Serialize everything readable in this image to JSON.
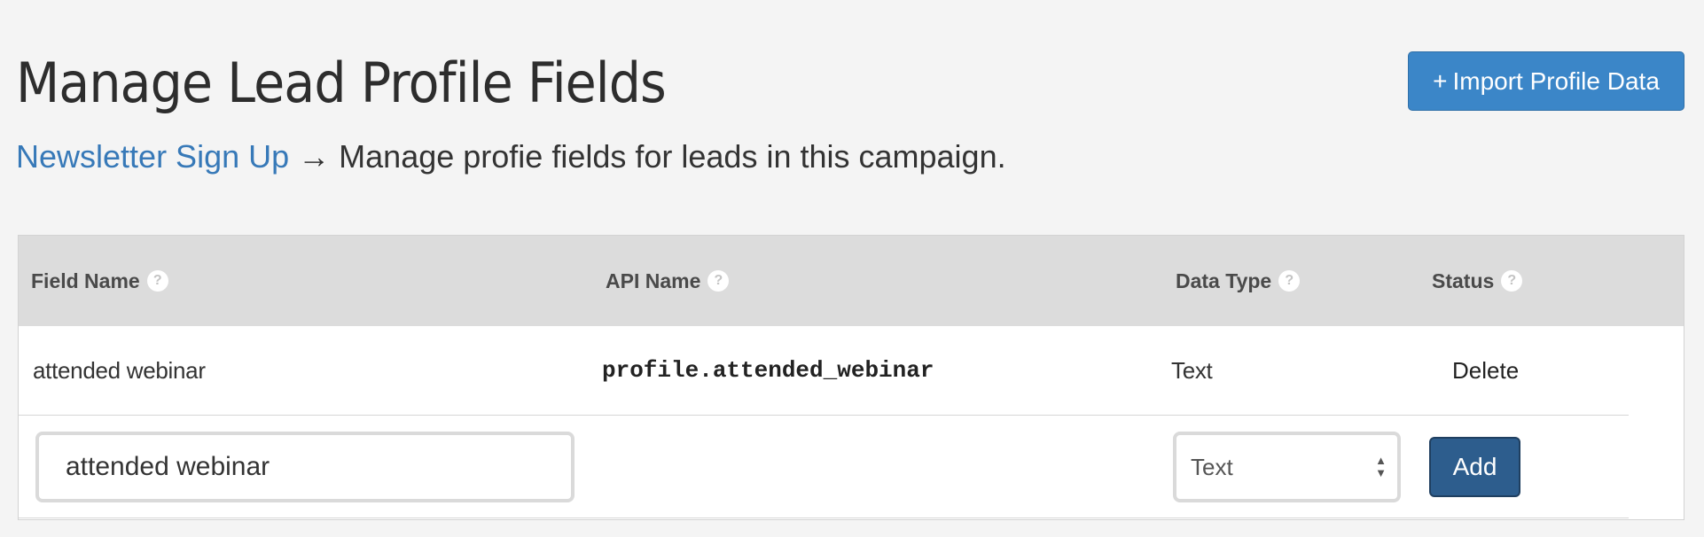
{
  "header": {
    "title": "Manage Lead Profile Fields",
    "breadcrumb_link": "Newsletter Sign Up",
    "breadcrumb_arrow": "→",
    "breadcrumb_text": "Manage profie fields for leads in this campaign.",
    "import_plus": "+",
    "import_label": "Import Profile Data"
  },
  "table": {
    "columns": [
      {
        "label": "Field Name",
        "help": "?"
      },
      {
        "label": "API Name",
        "help": "?"
      },
      {
        "label": "Data Type",
        "help": "?"
      },
      {
        "label": "Status",
        "help": "?"
      }
    ],
    "rows": [
      {
        "field_name": "attended webinar",
        "api_name": "profile.attended_webinar",
        "data_type": "Text",
        "action": "Delete"
      }
    ],
    "new_field": {
      "name_value": "attended webinar",
      "type_selected": "Text",
      "add_label": "Add"
    }
  },
  "colors": {
    "accent": "#3b86c8",
    "link": "#3779b8",
    "add_button": "#2d5d8d",
    "header_bg": "#dcdcdc",
    "page_bg": "#f4f4f4"
  },
  "icons": {
    "help": "question-circle-icon",
    "select_arrows": "updown-arrows-icon"
  }
}
